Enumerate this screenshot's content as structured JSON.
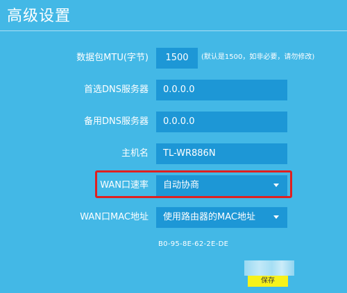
{
  "page": {
    "title": "高级设置"
  },
  "form": {
    "mtu": {
      "label": "数据包MTU(字节)",
      "value": "1500",
      "hint": "(默认是1500，如非必要，请勿修改)"
    },
    "primary_dns": {
      "label": "首选DNS服务器",
      "value": "0.0.0.0"
    },
    "secondary_dns": {
      "label": "备用DNS服务器",
      "value": "0.0.0.0"
    },
    "hostname": {
      "label": "主机名",
      "value": "TL-WR886N"
    },
    "wan_speed": {
      "label": "WAN口速率",
      "selected": "自动协商"
    },
    "wan_mac": {
      "label": "WAN口MAC地址",
      "selected": "使用路由器的MAC地址",
      "mac_address": "B0-95-8E-62-2E-DE"
    }
  },
  "actions": {
    "save_label": "保存"
  },
  "colors": {
    "background": "#43b8e6",
    "field": "#1d97d6",
    "highlight": "#e02020",
    "save_button": "#f7f21a"
  },
  "icons": {
    "dropdown": "caret-down-icon"
  }
}
